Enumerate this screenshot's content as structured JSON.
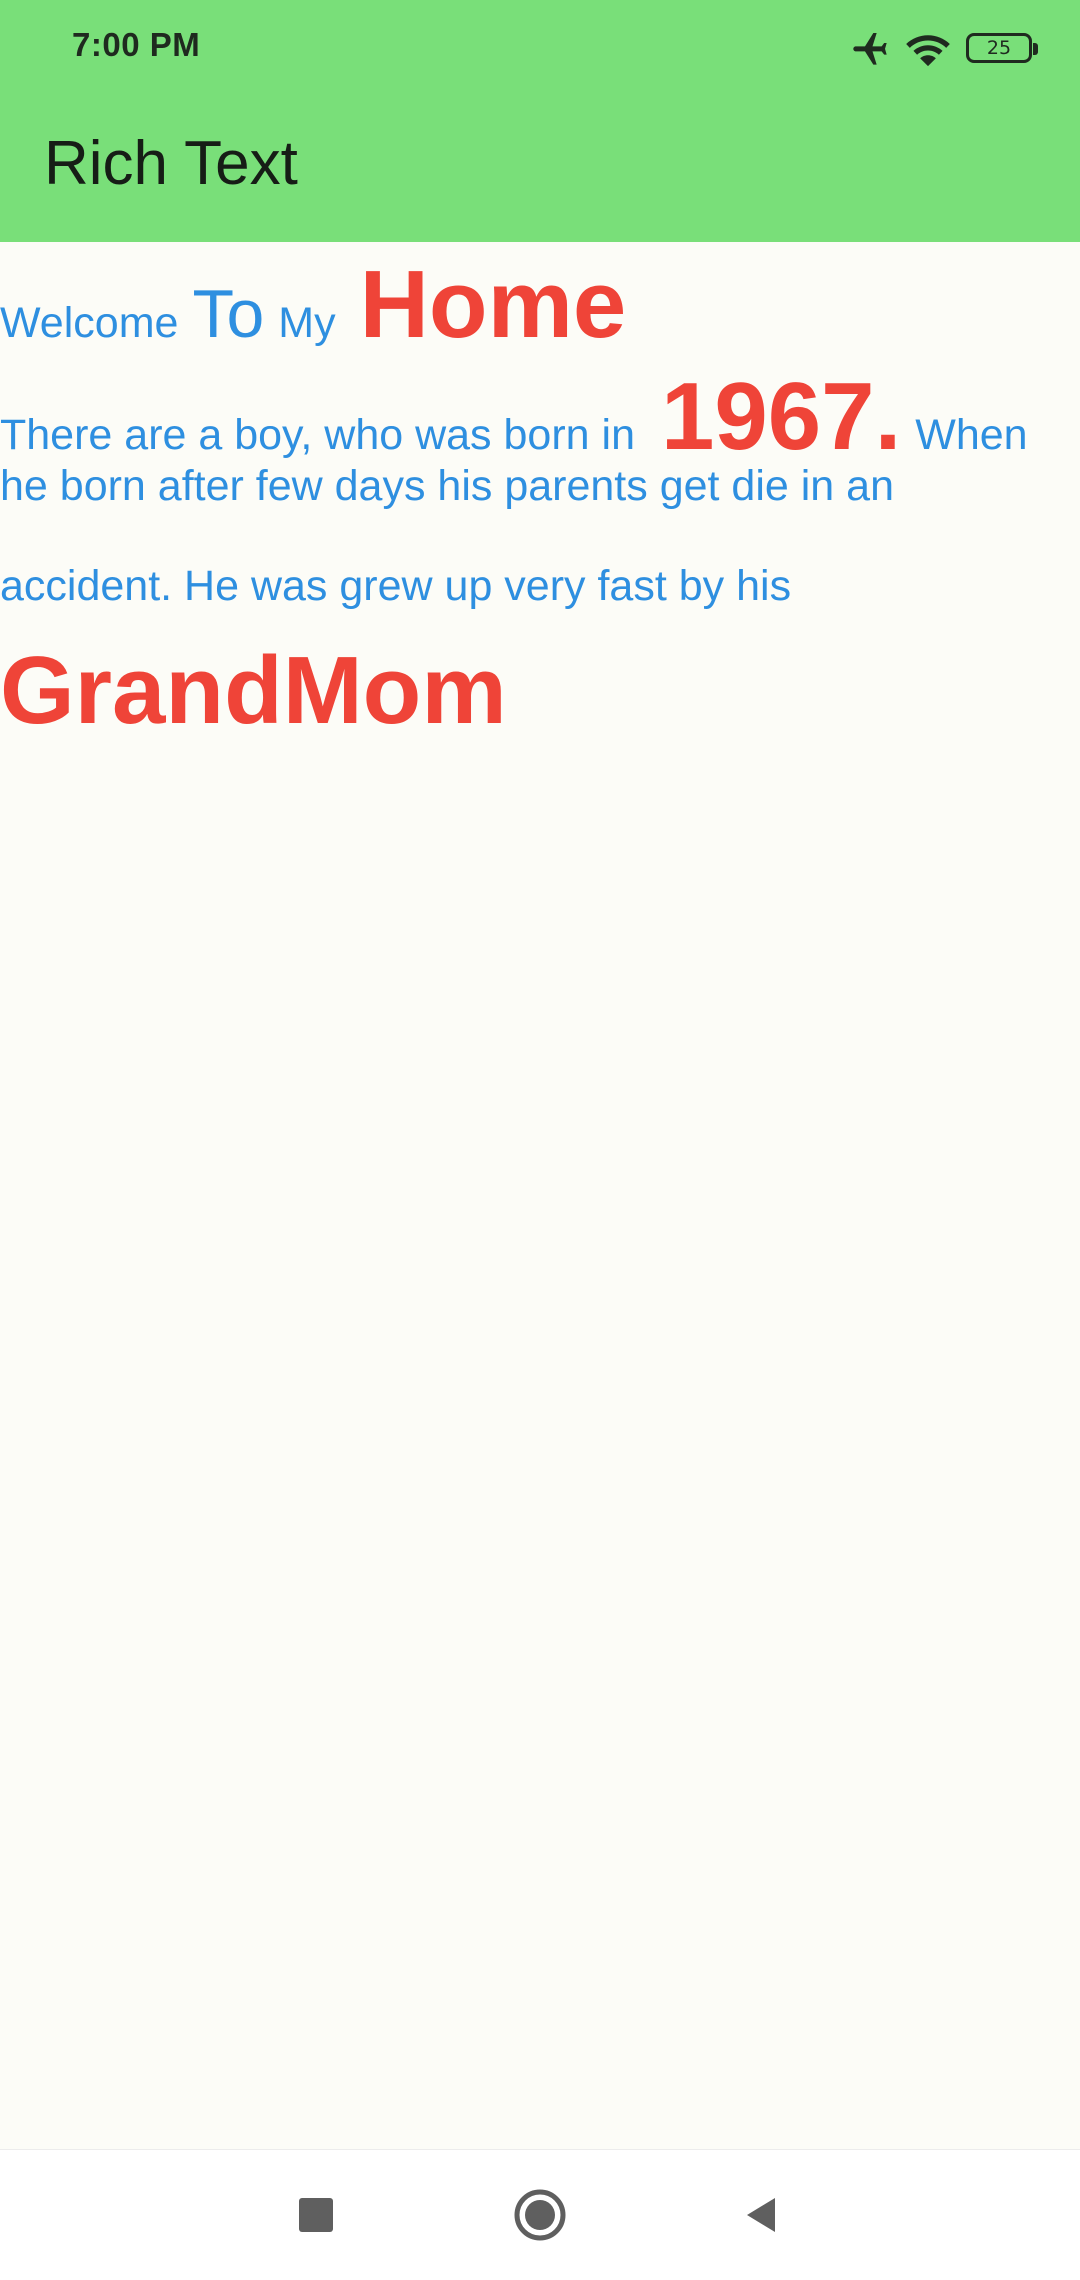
{
  "status_bar": {
    "time": "7:00 PM",
    "battery_level": "25",
    "icons": [
      "airplane-mode-icon",
      "wifi-icon",
      "battery-icon"
    ]
  },
  "app_bar": {
    "title": "Rich Text"
  },
  "rich_text": {
    "line1": [
      "Welcome",
      "To",
      "My",
      "Home"
    ],
    "line2": [
      "There are a boy, who was born in",
      "1967.",
      "When"
    ],
    "line3": "he born after few days his parents get die in an",
    "line4": "accident. He was grew up very fast by his",
    "line5": "GrandMom"
  },
  "navigation_bar": {
    "buttons": [
      "recent-apps",
      "home",
      "back"
    ]
  },
  "colors": {
    "app_bar": "#79df79",
    "background": "#fcfcf7",
    "text_blue": "#2e8fe0",
    "text_red": "#ef4438"
  }
}
